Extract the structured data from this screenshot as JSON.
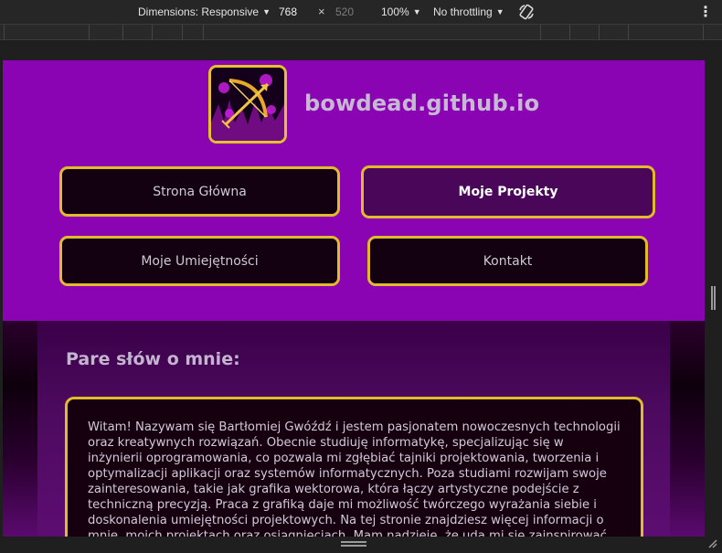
{
  "devtools": {
    "dimensions_label": "Dimensions: Responsive",
    "width_value": "768",
    "times_symbol": "×",
    "height_placeholder": "520",
    "zoom_label": "100%",
    "throttling_label": "No throttling",
    "icons": {
      "rotate": "rotate-icon",
      "more": "more-vert-icon"
    }
  },
  "site": {
    "title": "bowdead.github.io",
    "logo_icon": "bow-arrow-logo",
    "colors": {
      "header": "#8a04b4",
      "border": "#e1bb2c",
      "button": "#130010",
      "active_button": "#4a0659"
    },
    "nav": [
      {
        "label": "Strona Główna",
        "active": false
      },
      {
        "label": "Moje Projekty",
        "active": true
      },
      {
        "label": "Moje Umiejętności",
        "active": false
      },
      {
        "label": "Kontakt",
        "active": false
      }
    ],
    "about": {
      "heading": "Pare słów o mnie:",
      "text": "Witam! Nazywam się Bartłomiej Gwóźdź i jestem pasjonatem nowoczesnych technologii oraz kreatywnych rozwiązań. Obecnie studiuję informatykę, specjalizując się w inżynierii oprogramowania, co pozwala mi zgłębiać tajniki projektowania, tworzenia i optymalizacji aplikacji oraz systemów informatycznych. Poza studiami rozwijam swoje zainteresowania, takie jak grafika wektorowa, która łączy artystyczne podejście z techniczną precyzją. Praca z grafiką daje mi możliwość twórczego wyrażania siebie i doskonalenia umiejętności projektowych. Na tej stronie znajdziesz więcej informacji o mnie, moich projektach oraz osiągnięciach. Mam nadzieję, że uda mi się zainspirować"
    }
  }
}
